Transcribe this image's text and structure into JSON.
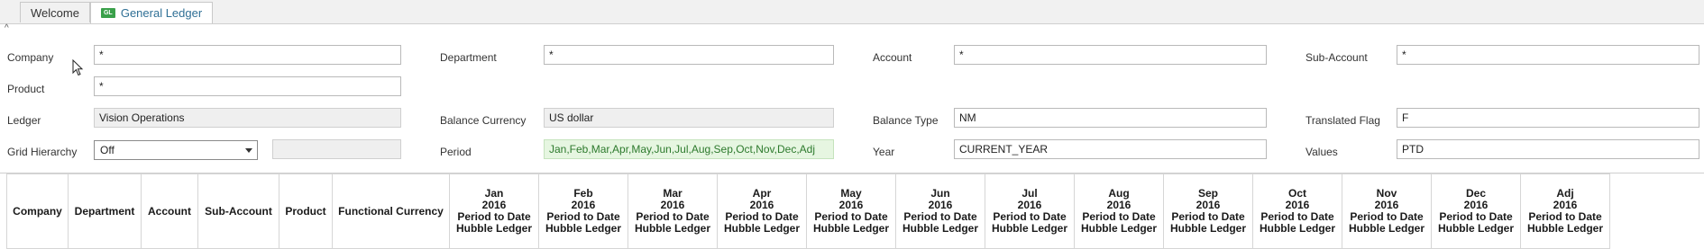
{
  "tabs": [
    {
      "label": "Welcome"
    },
    {
      "label": "General Ledger",
      "icon_text": "GL"
    }
  ],
  "form": {
    "company": {
      "label": "Company",
      "value": "*"
    },
    "department": {
      "label": "Department",
      "value": "*"
    },
    "account": {
      "label": "Account",
      "value": "*"
    },
    "sub_account": {
      "label": "Sub-Account",
      "value": "*"
    },
    "product": {
      "label": "Product",
      "value": "*"
    },
    "ledger": {
      "label": "Ledger",
      "value": "Vision Operations"
    },
    "balance_currency": {
      "label": "Balance Currency",
      "value": "US dollar"
    },
    "balance_type": {
      "label": "Balance Type",
      "value": "NM"
    },
    "translated_flag": {
      "label": "Translated Flag",
      "value": "F"
    },
    "grid_hierarchy": {
      "label": "Grid Hierarchy",
      "value": "Off",
      "extra_value": ""
    },
    "period": {
      "label": "Period",
      "value": "Jan,Feb,Mar,Apr,May,Jun,Jul,Aug,Sep,Oct,Nov,Dec,Adj"
    },
    "year": {
      "label": "Year",
      "value": "CURRENT_YEAR"
    },
    "values": {
      "label": "Values",
      "value": "PTD"
    }
  },
  "grid": {
    "dimension_headers": [
      "Company",
      "Department",
      "Account",
      "Sub-Account",
      "Product",
      "Functional Currency"
    ],
    "period_headers": [
      {
        "month": "Jan",
        "year": "2016",
        "type": "Period to Date",
        "ledger": "Hubble Ledger"
      },
      {
        "month": "Feb",
        "year": "2016",
        "type": "Period to Date",
        "ledger": "Hubble Ledger"
      },
      {
        "month": "Mar",
        "year": "2016",
        "type": "Period to Date",
        "ledger": "Hubble Ledger"
      },
      {
        "month": "Apr",
        "year": "2016",
        "type": "Period to Date",
        "ledger": "Hubble Ledger"
      },
      {
        "month": "May",
        "year": "2016",
        "type": "Period to Date",
        "ledger": "Hubble Ledger"
      },
      {
        "month": "Jun",
        "year": "2016",
        "type": "Period to Date",
        "ledger": "Hubble Ledger"
      },
      {
        "month": "Jul",
        "year": "2016",
        "type": "Period to Date",
        "ledger": "Hubble Ledger"
      },
      {
        "month": "Aug",
        "year": "2016",
        "type": "Period to Date",
        "ledger": "Hubble Ledger"
      },
      {
        "month": "Sep",
        "year": "2016",
        "type": "Period to Date",
        "ledger": "Hubble Ledger"
      },
      {
        "month": "Oct",
        "year": "2016",
        "type": "Period to Date",
        "ledger": "Hubble Ledger"
      },
      {
        "month": "Nov",
        "year": "2016",
        "type": "Period to Date",
        "ledger": "Hubble Ledger"
      },
      {
        "month": "Dec",
        "year": "2016",
        "type": "Period to Date",
        "ledger": "Hubble Ledger"
      },
      {
        "month": "Adj",
        "year": "2016",
        "type": "Period to Date",
        "ledger": "Hubble Ledger"
      }
    ]
  },
  "colors": {
    "accent_tab_text": "#2f6f95",
    "gl_icon": "#3aa04a",
    "period_field_bg": "#e6f6e1"
  }
}
